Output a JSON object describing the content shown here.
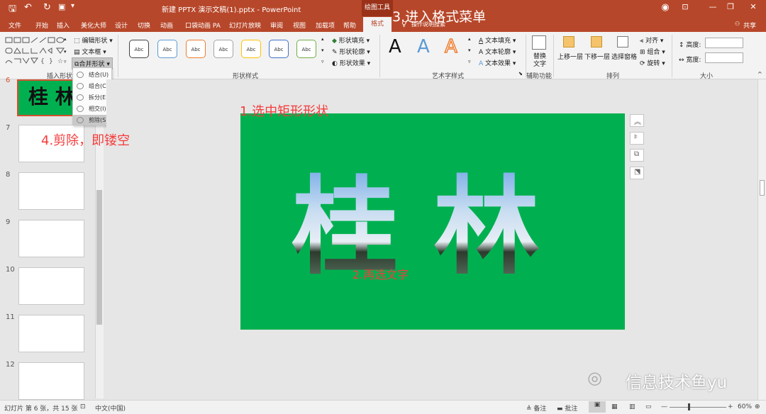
{
  "titlebar": {
    "doc_title": "新建 PPTX 演示文稿(1).pptx  -  PowerPoint",
    "contextual_group": "绘图工具",
    "win_minimize": "—",
    "win_restore": "❐",
    "win_close": "✕",
    "ribbon_toggle": "⊡"
  },
  "tabs": [
    "文件",
    "开始",
    "插入",
    "美化大师",
    "设计",
    "切换",
    "动画",
    "口袋动画 PA",
    "幻灯片放映",
    "审阅",
    "视图",
    "加载项",
    "帮助"
  ],
  "active_tab": "格式",
  "tell_me": "操作说明搜索",
  "share": "共享",
  "ribbon": {
    "insert_shapes": {
      "label": "插入形状",
      "edit_shape": "编辑形状",
      "text_box": "文本框",
      "merge_shapes": "合并形状"
    },
    "shape_styles": {
      "label": "形状样式",
      "preset_text": "Abc",
      "preset_colors": [
        "#444444",
        "#5b9bd5",
        "#ed7d31",
        "#a5a5a5",
        "#ffc000",
        "#4472c4",
        "#70ad47"
      ],
      "fill": "形状填充",
      "outline": "形状轮廓",
      "effects": "形状效果"
    },
    "wordart": {
      "label": "艺术字样式",
      "letters": [
        "A",
        "A",
        "A"
      ],
      "text_fill": "文本填充",
      "text_outline": "文本轮廓",
      "text_effects": "文本效果"
    },
    "accessibility": {
      "label": "辅助功能",
      "alt_text_1": "替换",
      "alt_text_2": "文字"
    },
    "arrange": {
      "label": "排列",
      "bring_forward": "上移一层",
      "send_backward": "下移一层",
      "selection_pane": "选择窗格",
      "align": "对齐",
      "group": "组合",
      "rotate": "旋转"
    },
    "size": {
      "label": "大小",
      "height": "高度:",
      "width": "宽度:"
    }
  },
  "merge_menu": [
    "结合(U)",
    "组合(C)",
    "拆分(E)",
    "相交(I)",
    "剪除(S)"
  ],
  "thumbnails": {
    "numbers": [
      "6",
      "7",
      "8",
      "9",
      "10",
      "11",
      "12"
    ],
    "slide6_text": "桂 林"
  },
  "slide": {
    "text": "桂  林",
    "background": "#00b050"
  },
  "annotations": {
    "step1": "1.选中矩形形状",
    "step2": "2.再选文字",
    "step3": "3.进入格式菜单",
    "step4": "4.剪除，即镂空"
  },
  "watermark": "信息技术鱼yu",
  "status": {
    "slide_info": "幻灯片 第 6 张，共 15 张",
    "language": "中文(中国)",
    "notes": "备注",
    "comments": "批注",
    "zoom": "60%",
    "zoom_minus": "—",
    "zoom_plus": "+"
  },
  "colors": {
    "accent": "#b7472a",
    "annotation": "#f53b3b"
  }
}
